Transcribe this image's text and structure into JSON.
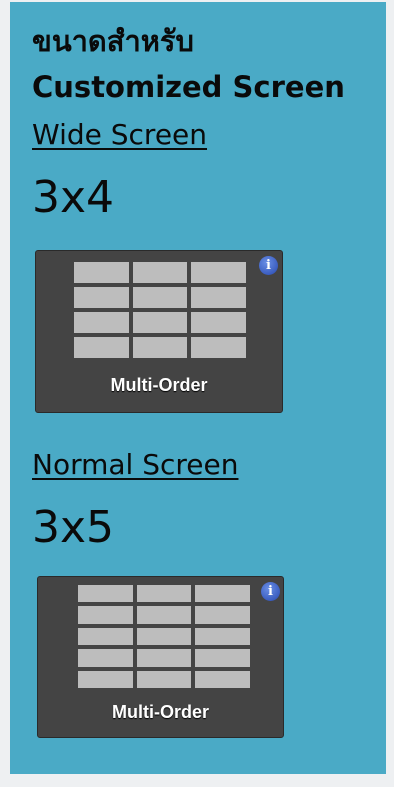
{
  "heading": {
    "line1": "ขนาดสำหรับ",
    "line2": "Customized Screen"
  },
  "sections": [
    {
      "link_label": "Wide Screen",
      "grid_size": "3x4",
      "tile_label": "Multi-Order",
      "columns": 3,
      "rows": 4
    },
    {
      "link_label": "Normal Screen",
      "grid_size": "3x5",
      "tile_label": "Multi-Order",
      "columns": 3,
      "rows": 5
    }
  ],
  "info_glyph": "i",
  "colors": {
    "panel": "#4aaac6",
    "tile": "#444444",
    "cell": "#bdbdbd",
    "info": "#2748b0"
  }
}
